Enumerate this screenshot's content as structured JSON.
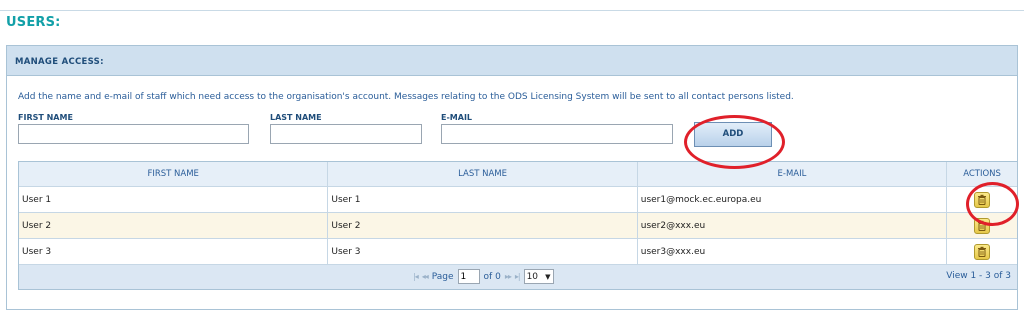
{
  "page": {
    "title": "USERS:"
  },
  "manage_access": {
    "header": "MANAGE ACCESS:",
    "description": "Add the name and e-mail of staff which need access to the organisation's account. Messages relating to the ODS Licensing System will be sent to all contact persons listed.",
    "first_name_label": "FIRST NAME",
    "first_name_value": "",
    "last_name_label": "LAST NAME",
    "last_name_value": "",
    "email_label": "E-MAIL",
    "email_value": "",
    "add_label": "ADD"
  },
  "table": {
    "columns": [
      "FIRST NAME",
      "LAST NAME",
      "E-MAIL",
      "ACTIONS"
    ],
    "rows": [
      {
        "first_name": "User 1",
        "last_name": "User 1",
        "email": "user1@mock.ec.europa.eu"
      },
      {
        "first_name": "User 2",
        "last_name": "User 2",
        "email": "user2@xxx.eu"
      },
      {
        "first_name": "User 3",
        "last_name": "User 3",
        "email": "user3@xxx.eu"
      }
    ]
  },
  "pager": {
    "page_label": "Page",
    "page_value": "1",
    "of_label": "of 0",
    "page_size": "10",
    "records": "View 1 - 3 of 3",
    "icons": [
      "first-page-icon",
      "prev-page-icon",
      "next-page-icon",
      "last-page-icon"
    ]
  },
  "annotation": {
    "color": "#e0202a"
  },
  "colors": {
    "title": "#12a0a8",
    "header_bg": "#cfe0ef",
    "text_blue": "#2a5d99",
    "alt_row": "#fbf6e6"
  }
}
